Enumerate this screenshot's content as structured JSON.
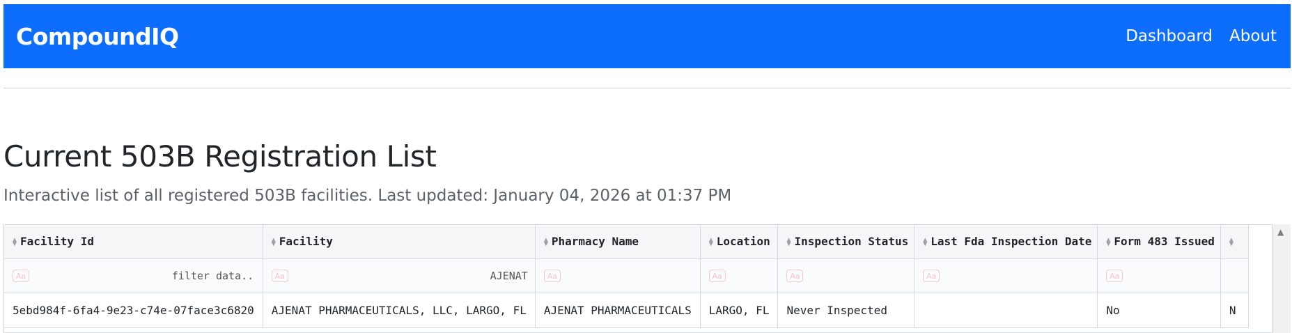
{
  "navbar": {
    "brand": "CompoundIQ",
    "links": [
      "Dashboard",
      "About"
    ]
  },
  "page": {
    "title": "Current 503B Registration List",
    "subtitle": "Interactive list of all registered 503B facilities. Last updated: January 04, 2026 at 01:37 PM"
  },
  "table": {
    "columns": [
      "Facility Id",
      "Facility",
      "Pharmacy Name",
      "Location",
      "Inspection Status",
      "Last Fda Inspection Date",
      "Form 483 Issued",
      ""
    ],
    "filters": {
      "placeholder": "filter data...",
      "facility_value": "AJENAT",
      "aa_icon": "Aa"
    },
    "rows": [
      [
        "5ebd984f-6fa4-9e23-c74e-07face3c6820",
        "AJENAT PHARMACEUTICALS, LLC, LARGO, FL",
        "AJENAT PHARMACEUTICALS",
        "LARGO, FL",
        "Never Inspected",
        "",
        "No",
        "N"
      ]
    ]
  },
  "icons": {
    "sort": "sort-arrows-icon",
    "scroll_up": "scroll-up-arrow-icon"
  }
}
